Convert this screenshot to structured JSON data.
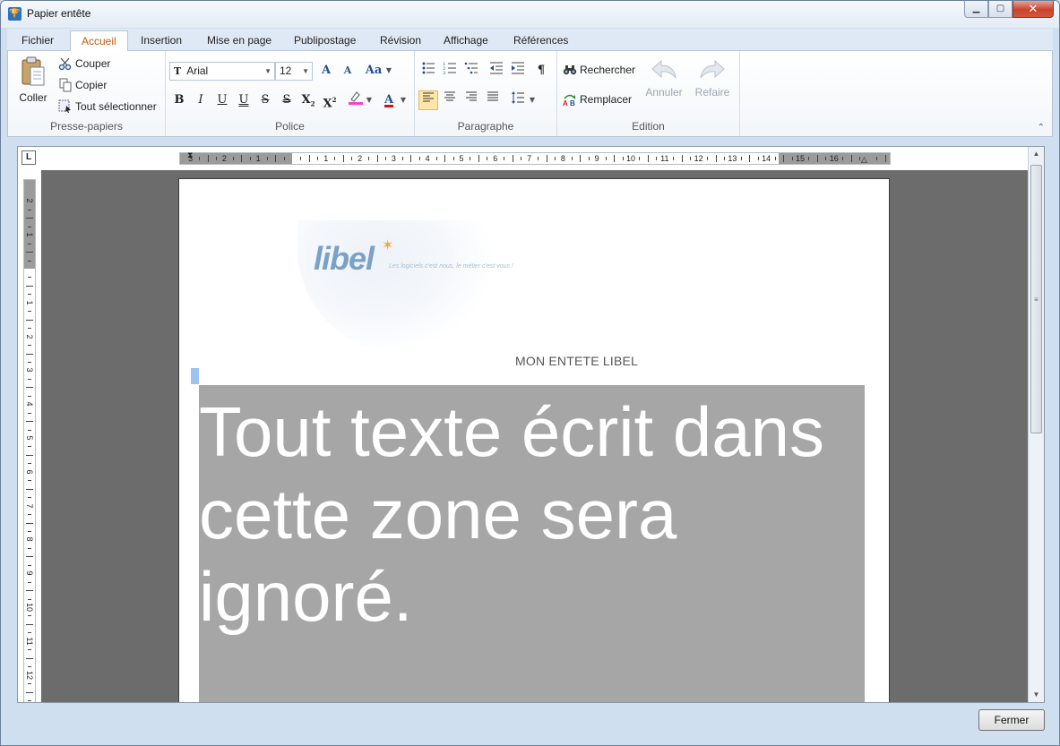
{
  "window": {
    "title": "Papier entête"
  },
  "tabs": [
    {
      "label": "Fichier"
    },
    {
      "label": "Accueil"
    },
    {
      "label": "Insertion"
    },
    {
      "label": "Mise en page"
    },
    {
      "label": "Publipostage"
    },
    {
      "label": "Révision"
    },
    {
      "label": "Affichage"
    },
    {
      "label": "Références"
    }
  ],
  "ribbon": {
    "clipboard": {
      "label": "Presse-papiers",
      "paste": "Coller",
      "cut": "Couper",
      "copy": "Copier",
      "select_all": "Tout sélectionner"
    },
    "font": {
      "label": "Police",
      "family": "Arial",
      "size": "12",
      "grow": "A",
      "shrink": "A",
      "change_case": "Aa",
      "bold": "B",
      "italic": "I",
      "underline": "U",
      "double_underline": "U",
      "strike": "S",
      "double_strike": "S",
      "subscript": "X",
      "superscript": "X",
      "font_color": "A"
    },
    "paragraph": {
      "label": "Paragraphe",
      "pilcrow": "¶"
    },
    "edition": {
      "label": "Edition",
      "find": "Rechercher",
      "replace": "Remplacer",
      "undo": "Annuler",
      "redo": "Refaire"
    }
  },
  "ruler": {
    "h_left_numbers": [
      "3",
      "2",
      "1"
    ],
    "h_numbers": [
      "1",
      "2",
      "3",
      "4",
      "5",
      "6",
      "7",
      "8",
      "9",
      "10",
      "11",
      "12",
      "13",
      "14",
      "15",
      "16"
    ],
    "v_top_numbers": [
      "2",
      "1"
    ],
    "v_numbers": [
      "1",
      "2",
      "3",
      "4",
      "5",
      "6",
      "7",
      "8",
      "9",
      "10",
      "11",
      "12"
    ],
    "corner": "L"
  },
  "document": {
    "tagline": "Les logiciels c'est nous, le métier c'est vous !",
    "logo_text": "libel",
    "header_title": "MON ENTETE LIBEL",
    "body_text": "Tout texte écrit dans cette zone sera ignoré."
  },
  "footer": {
    "close_label": "Fermer"
  },
  "colors": {
    "accent_tab": "#c15b0e",
    "body_zone": "#a6a6a6",
    "logo": "#7aa2c6"
  }
}
